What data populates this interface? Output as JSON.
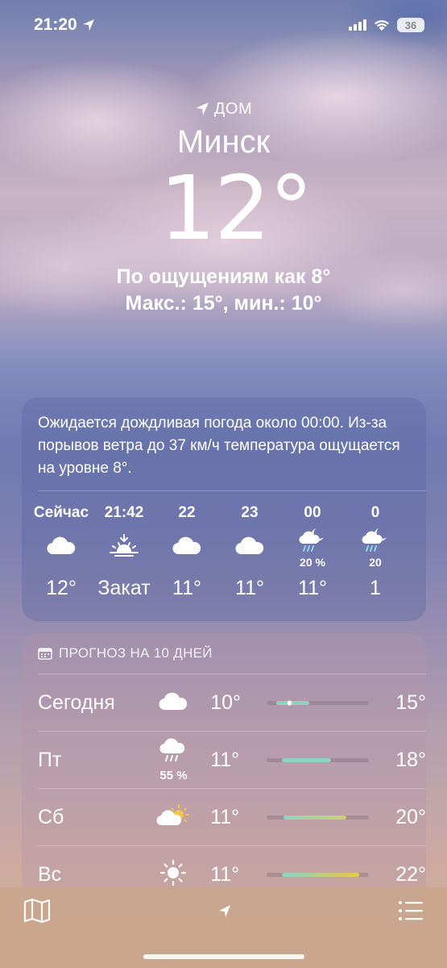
{
  "status": {
    "time": "21:20",
    "battery": "36"
  },
  "hero": {
    "location_label": "ДОМ",
    "city": "Минск",
    "temperature": "12°",
    "feels_like": "По ощущениям как 8°",
    "range": "Макс.: 15°, мин.: 10°"
  },
  "hourly": {
    "summary": "Ожидается дождливая погода около 00:00. Из-за порывов ветра до 37 км/ч температура ощущается на уровне 8°.",
    "items": [
      {
        "label": "Сейчас",
        "icon": "cloud-icon",
        "temp": "12°",
        "prob": ""
      },
      {
        "label": "21:42",
        "icon": "sunset-icon",
        "temp": "Закат",
        "prob": ""
      },
      {
        "label": "22",
        "icon": "cloud-icon",
        "temp": "11°",
        "prob": ""
      },
      {
        "label": "23",
        "icon": "cloud-icon",
        "temp": "11°",
        "prob": ""
      },
      {
        "label": "00",
        "icon": "moon-rain-icon",
        "temp": "11°",
        "prob": "20 %"
      },
      {
        "label": "0",
        "icon": "moon-rain-icon",
        "temp": "1",
        "prob": "20"
      }
    ]
  },
  "daily": {
    "header": "ПРОГНОЗ НА 10 ДНЕЙ",
    "days": [
      {
        "name": "Сегодня",
        "icon": "cloud-icon",
        "prob": "",
        "min": "10°",
        "max": "15°",
        "range_start": 0.1,
        "range_end": 0.42,
        "current": 0.2
      },
      {
        "name": "Пт",
        "icon": "rain-icon",
        "prob": "55 %",
        "min": "11°",
        "max": "18°",
        "range_start": 0.15,
        "range_end": 0.63,
        "current": null
      },
      {
        "name": "Сб",
        "icon": "partly-sunny-icon",
        "prob": "",
        "min": "11°",
        "max": "20°",
        "range_start": 0.17,
        "range_end": 0.78,
        "current": null
      },
      {
        "name": "Вс",
        "icon": "sun-icon",
        "prob": "",
        "min": "11°",
        "max": "22°",
        "range_start": 0.15,
        "range_end": 0.91,
        "current": null
      }
    ]
  },
  "colors": {
    "bar_cool": "#8ed3c0",
    "bar_warm": "#e8c84a"
  }
}
